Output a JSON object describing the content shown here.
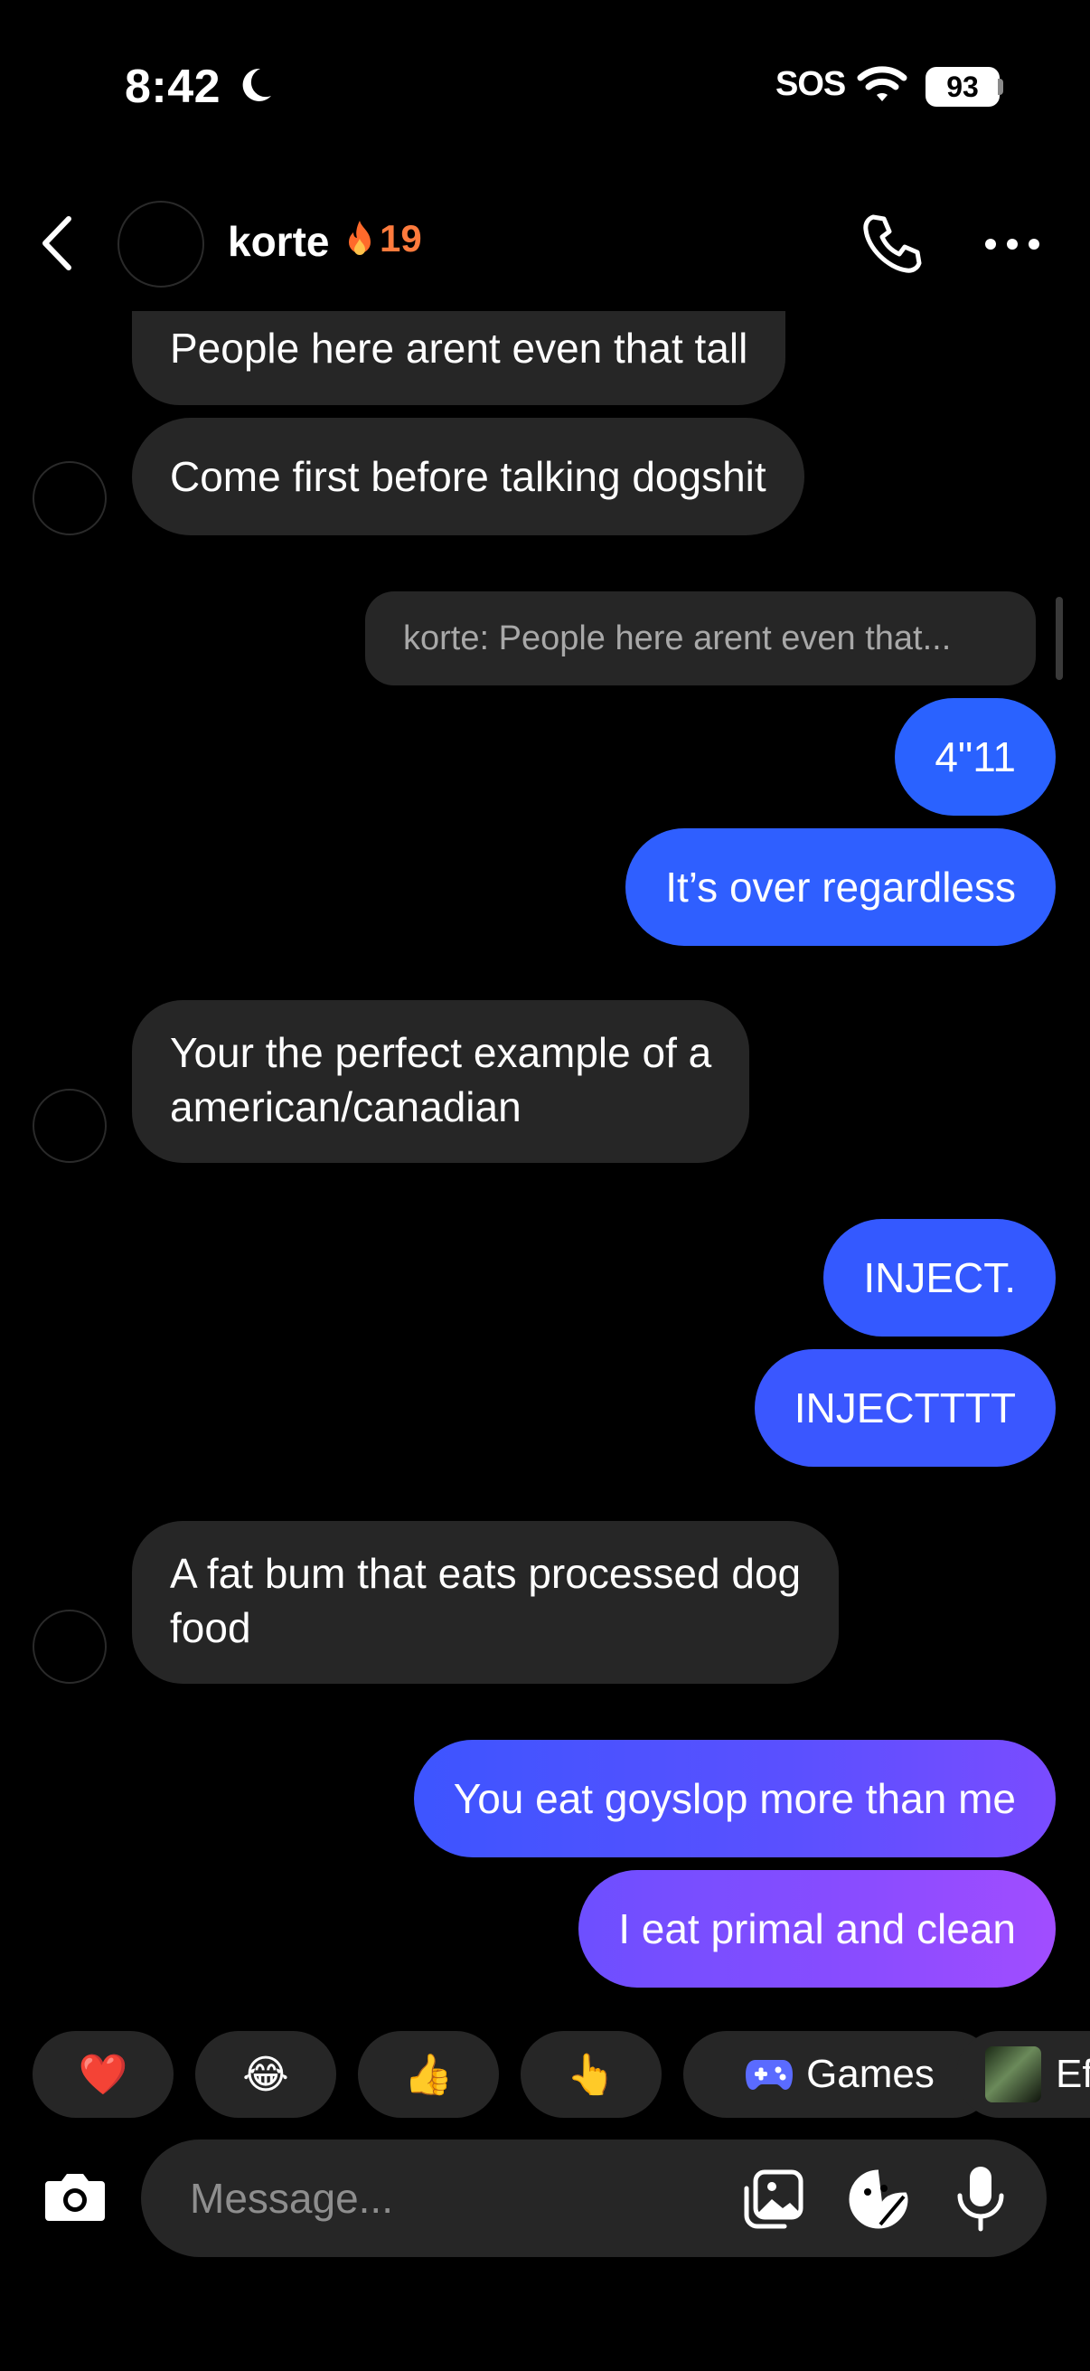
{
  "status_bar": {
    "time": "8:42",
    "sos": "SOS",
    "battery": "93"
  },
  "header": {
    "name": "korte",
    "streak": "19"
  },
  "messages": [
    {
      "dir": "in",
      "text": "People here arent even that tall"
    },
    {
      "dir": "in",
      "text": "Come first before talking dogshit"
    },
    {
      "dir": "reply",
      "text": "korte: People here arent even that..."
    },
    {
      "dir": "out",
      "text": "4\"11"
    },
    {
      "dir": "out",
      "text": "It’s over regardless"
    },
    {
      "dir": "in",
      "line1": "Your the perfect example of a",
      "line2": "american/canadian"
    },
    {
      "dir": "out",
      "text": "INJECT."
    },
    {
      "dir": "out",
      "text": "INJECTTTT"
    },
    {
      "dir": "in",
      "line1": "A fat bum that eats processed dog",
      "line2": "food"
    },
    {
      "dir": "out",
      "text": "You eat goyslop more than me"
    },
    {
      "dir": "out",
      "text": "I eat primal and clean"
    }
  ],
  "quick_reactions": {
    "heart": "❤️",
    "laugh": "😂",
    "thumbs_up": "👍",
    "point": "👆",
    "games_label": "Games",
    "effects_label": "Ef"
  },
  "composer": {
    "placeholder": "Message..."
  },
  "colors": {
    "background": "#000000",
    "incoming_bubble": "#262626",
    "outgoing_blue": "#3a5bff",
    "outgoing_purple": "#a14dff",
    "streak": "#ff7b3d"
  }
}
